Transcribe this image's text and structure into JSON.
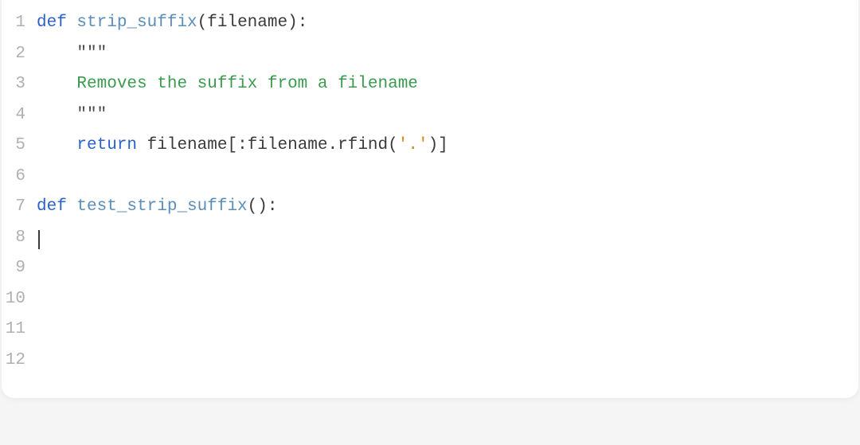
{
  "editor": {
    "lines": [
      {
        "num": "1"
      },
      {
        "num": "2"
      },
      {
        "num": "3"
      },
      {
        "num": "4"
      },
      {
        "num": "5"
      },
      {
        "num": "6"
      },
      {
        "num": "7"
      },
      {
        "num": "8"
      },
      {
        "num": "9"
      },
      {
        "num": "10"
      },
      {
        "num": "11"
      },
      {
        "num": "12"
      }
    ],
    "tokens": {
      "def1": "def",
      "sp": " ",
      "fn1": "strip_suffix",
      "parens1_open": "(",
      "param1": "filename",
      "parens1_close": ")",
      "colon1": ":",
      "indent": "    ",
      "tripquote1": "\"\"\"",
      "docline": "Removes the suffix from a filename",
      "tripquote2": "\"\"\"",
      "return": "return",
      "ret_expr_a": " filename",
      "ret_expr_b": "[:",
      "ret_expr_c": "filename",
      "ret_expr_d": ".",
      "ret_expr_e": "rfind",
      "ret_expr_f": "(",
      "ret_str": "'.'",
      "ret_expr_g": ")]",
      "def2": "def",
      "fn2": "test_strip_suffix",
      "parens2": "():"
    }
  }
}
